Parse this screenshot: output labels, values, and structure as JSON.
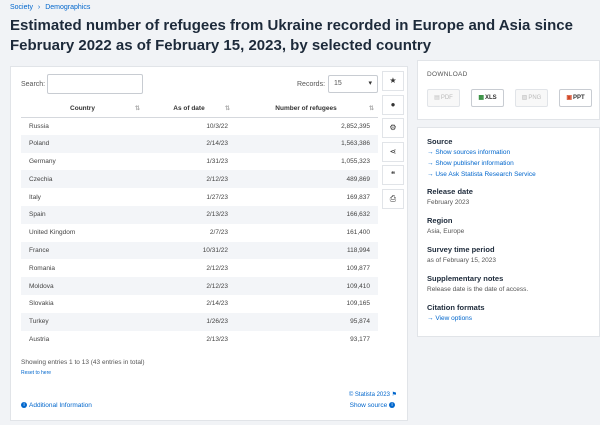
{
  "breadcrumb": {
    "items": [
      "Society",
      "›",
      "Demographics"
    ]
  },
  "page_title": "Estimated number of refugees from Ukraine recorded in Europe and Asia since February 2022 as of February 15, 2023, by selected country",
  "table_controls": {
    "search_label": "Search:",
    "search_value": "",
    "records_label": "Records:",
    "records_value": "15"
  },
  "table": {
    "columns": [
      "Country",
      "As of date",
      "Number of refugees"
    ],
    "rows": [
      [
        "Russia",
        "10/3/22",
        "2,852,395"
      ],
      [
        "Poland",
        "2/14/23",
        "1,563,386"
      ],
      [
        "Germany",
        "1/31/23",
        "1,055,323"
      ],
      [
        "Czechia",
        "2/12/23",
        "489,869"
      ],
      [
        "Italy",
        "1/27/23",
        "169,837"
      ],
      [
        "Spain",
        "2/13/23",
        "166,632"
      ],
      [
        "United Kingdom",
        "2/7/23",
        "161,400"
      ],
      [
        "France",
        "10/31/22",
        "118,994"
      ],
      [
        "Romania",
        "2/12/23",
        "109,877"
      ],
      [
        "Moldova",
        "2/12/23",
        "109,410"
      ],
      [
        "Slovakia",
        "2/14/23",
        "109,165"
      ],
      [
        "Turkey",
        "1/26/23",
        "95,874"
      ],
      [
        "Austria",
        "2/13/23",
        "93,177"
      ]
    ]
  },
  "footer": {
    "showing": "Showing entries 1 to 13 (43 entries in total)",
    "reset": "Reset to here",
    "copyright": "© Statista 2023",
    "additional": "Additional Information",
    "show_source": "Show source"
  },
  "tools": {
    "icons": [
      "star-icon",
      "bell-icon",
      "gear-icon",
      "share-icon",
      "quote-icon",
      "print-icon"
    ],
    "glyphs": [
      "★",
      "●",
      "⚙",
      "⋖",
      "❝",
      "⎙"
    ]
  },
  "download": {
    "title": "DOWNLOAD",
    "buttons": [
      {
        "label": "PDF",
        "glyph": "▤",
        "active": false
      },
      {
        "label": "XLS",
        "glyph": "▦",
        "active": true
      },
      {
        "label": "PNG",
        "glyph": "▨",
        "active": false
      },
      {
        "label": "PPT",
        "glyph": "▣",
        "active": true
      }
    ]
  },
  "info": {
    "source_heading": "Source",
    "source_links": [
      "Show sources information",
      "Show publisher information",
      "Use Ask Statista Research Service"
    ],
    "release_heading": "Release date",
    "release_value": "February 2023",
    "region_heading": "Region",
    "region_value": "Asia, Europe",
    "survey_heading": "Survey time period",
    "survey_value": "as of February 15, 2023",
    "notes_heading": "Supplementary notes",
    "notes_value": "Release date is the date of access.",
    "citation_heading": "Citation formats",
    "citation_link": "View options"
  },
  "colors": {
    "link": "#0066cc",
    "title": "#1d2a3a",
    "background": "#f1f3f6"
  }
}
